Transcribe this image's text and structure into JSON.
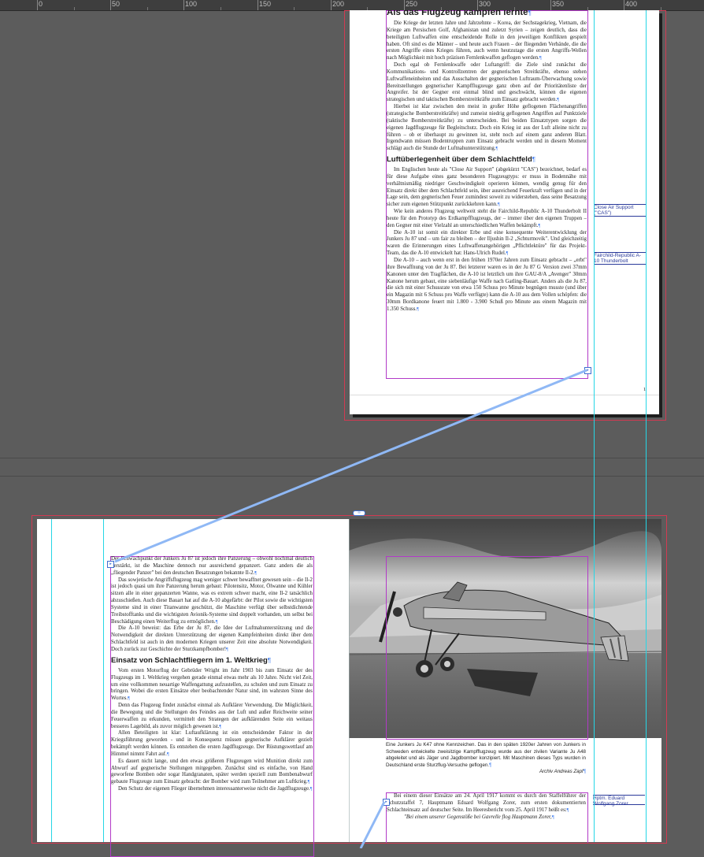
{
  "ruler": {
    "labels": [
      "0",
      "50",
      "100",
      "150",
      "200",
      "250",
      "300",
      "350",
      "400"
    ]
  },
  "page1": {
    "heading1": "Als das Flugzeug kämpfen lernte",
    "paragraphs1": [
      "Die Kriege der letzten Jahre und Jahrzehnte – Korea, der Sechstagekrieg, Vietnam, die Kriege am Persischen Golf, Afghanistan und zuletzt Syrien – zeigen deutlich, dass die beteiligten Luftwaffen eine entscheidende Rolle in den jeweiligen Konflikten gespielt haben. Oft sind es die Männer – und heute auch Frauen – der fliegenden Verbände, die die ersten Angriffe eines Krieges führen, auch wenn heutzutage die ersten Angriffs-Wellen nach Möglichkeit mit hoch präzisen Fernlenkwaffen geflogen werden.",
      "Doch egal ob Fernlenkwaffe oder Luftangriff: die Ziele sind zunächst die Kommunikations- und Kontrollzentren der gegnerischen Streitkräfte, ebenso stehen Luftwaffeneinheiten und das Ausschalten der gegnerischen Luftraum-Überwachung sowie Bereitstellungen gegnerischer Kampfflugzeuge ganz oben auf der Prioritätenliste der Angreifer. Ist der Gegner erst einmal blind und geschwächt, können die eigenen strategischen und taktischen Bomberstreitkräfte zum Einsatz gebracht werden.",
      "Hierbei ist klar zwischen den meist in großer Höhe geflogenen Flächenangriffen (strategische Bomberstreitkräfte) und zumeist niedrig geflogenen Angriffen auf Punktziele (taktische Bomberstreitkräfte) zu unterscheiden. Bei beiden Einsatztypen sorgen die eigenen Jagdflugzeuge für Begleitschutz. Doch ein Krieg ist aus der Luft alleine nicht zu führen – ob er überhaupt zu gewinnen ist, steht noch auf einem ganz anderen Blatt. Irgendwann müssen Bodentruppen zum Einsatz gebracht werden und in diesem Moment schlägt auch die Stunde der Luftnahunterstützung."
    ],
    "heading2": "Luftüberlegenheit über dem Schlachtfeld",
    "paragraphs2": [
      "Im Englischen heute als \"Close Air Support\" (abgekürzt \"CAS\") bezeichnet, bedarf es für diese Aufgabe eines ganz besonderen Flugzeugtyps: er muss in Bodennähe mit verhältnismäßig niedriger Geschwindigkeit operieren können, wendig genug für den Einsatz direkt über dem Schlachtfeld sein, über ausreichend Feuerkraft verfügen und in der Lage sein, dem gegnerischen Feuer zumindest soweit zu widerstehen, dass seine Besatzung sicher zum eigenen Stützpunkt zurückkehren kann.",
      "Wie kein anderes Flugzeug weltweit steht die Fairchild-Republic A-10 Thunderbolt II heute für den Prototyp des Erdkampfflugzeugs, der – immer über den eigenen Truppen – den Gegner mit einer Vielzahl an unterschiedlichen Waffen bekämpft.",
      "Die A-10 ist somit ein direkter Erbe und eine konsequente Weiterentwicklung der Junkers Ju 87 und – um fair zu bleiben – der Iljushin Il-2 „Schturmovik\". Und gleichzeitig waren die Erinnerungen eines Luftwaffenangehörigen „Pflichtlektüre\" für das Projekt-Team, das die A-10 entwickelt hat: Hans-Ulrich Rudel.",
      "Die A-10 – auch wenn erst in den frühen 1970er Jahren zum Einsatz gebracht – „erbt\" ihre Bewaffnung von der Ju 87. Bei letzterer waren es in der Ju 87 G Version zwei 37mm Kanonen unter den Tragflächen, die A-10 ist letztlich um ihre GAU-8/A „Avenger\" 30mm Kanone herum gebaut, eine siebenläufige Waffe nach Gatling-Bauart. Anders als die Ju 87, die sich mit einer Schussrate von etwa 150 Schuss pro Minute begnügen musste (und über ein Magazin mit 6 Schuss pro Waffe verfügte) kann die A-10 aus dem Vollen schöpfen: die 30mm Bordkanone feuert mit 1.800 - 3.900 Schuß pro Minute aus einem Magazin mit 1.350 Schuss."
    ],
    "note1": "Close Air Support (\"CAS\")",
    "note2": "Fairchild-Republic A-10 Thunderbolt",
    "page_number": "1"
  },
  "page2": {
    "paragraphs1": [
      "Der Schwachpunkt der Junkers Ju 87 ist jedoch ihre Panzerung – obwohl nochmal deutlich verstärkt, ist die Maschine dennoch nur ausreichend gepanzert. Ganz anders die als „fliegender Panzer\" bei den deutschen Besatzungen bekannte Il-2.",
      "Das sowjetische Angriffsflugzeug mag weniger schwer bewaffnet gewesen sein – die Il-2 ist jedoch quasi um ihre Panzerung herum gebaut: Pilotensitz, Motor, Ölwanne und Kühler sitzen alle in einer gepanzerten Wanne, was es extrem schwer macht, eine Il-2 tatsächlich abzuschießen. Auch diese Bauart hat auf die A-10 abgefärbt: der Pilot sowie die wichtigsten Systeme sind in einer Titanwanne geschützt, die Maschine verfügt über selbstdichtende Treibstofftanks und die wichtigsten Avionik-Systeme sind doppelt vorhanden, um selbst bei Beschädigung einen Weiterflug zu ermöglichen.",
      "Die A-10 beweist: das Erbe der Ju 87, die Idee der Luftnahunterstützung und die Notwendigkeit der direkten Unterstützung der eigenen Kampfeinheiten direkt über dem Schlachtfeld ist auch in den modernen Kriegen unserer Zeit eine absolute Notwendigkeit. Doch zurück zur Geschichte der Sturzkampfbomber!"
    ],
    "heading": "Einsatz von Schlachtfliegern im 1. Weltkrieg",
    "paragraphs2": [
      "Vom ersten Motorflug der Gebrüder Wright im Jahr 1903 bis zum Einsatz der des Flugzeugs im 1. Weltkrieg vergehen gerade einmal etwas mehr als 10 Jahre. Nicht viel Zeit, um eine vollkommen neuartige Waffengattung aufzustellen, zu schulen und zum Einsatz zu bringen. Wobei die ersten Einsätze eher beobachtender Natur sind, im wahrsten Sinne des Wortes.",
      "Denn das Flugzeug findet zunächst einmal als Aufklärer Verwendung. Die Möglichkeit, die Bewegung und die Stellungen des Feindes aus der Luft und außer Reichweite seiner Feuerwaffen zu erkunden, vermittelt den Strategen der aufklärenden Seite ein weitaus besseres Lagebild, als zuvor möglich gewesen ist.",
      "Allen Beteiligten ist klar: Luftaufklärung ist ein entscheidender Faktor in der Kriegsführung geworden - und in Konsequenz müssen gegnerische Aufklärer gezielt bekämpft werden können. Es entstehen die ersten Jagdflugzeuge. Der Rüstungswettlauf am Himmel nimmt Fahrt auf.",
      "Es dauert nicht lange, und den etwas größeren Flugzeugen wird Munition direkt zum Abwurf auf gegnerische Stellungen mitgegeben. Zunächst sind es einfache, von Hand geworfene Bomben oder sogar Handgranaten, später werden speziell zum Bombenabwurf gebaute Flugzeuge zum Einsatz gebracht: der Bomber wird zum Teilnehmer am Luftkrieg.",
      "Den Schutz der eigenen Flieger übernehmen interessanterweise nicht die Jagdflugzeuge."
    ],
    "caption": "Eine Junkers Ju K47 ohne Kennzeichen. Das in den späten 1920er Jahren von Junkers in Schweden entwickelte zweisitzige Kampfflugzeug wurde aus der zivilen Variante Ju A48 abgeleitet und als Jäger und Jagdbomber konzipiert. Mit Maschinen dieses Typs wurden in Deutschland erste Sturzflug-Versuche geflogen.",
    "caption_credit": "Archiv Andreas Zapf",
    "paragraph3": "Bei einem dieser Einsätze am 24. April 1917 kommt es durch den Staffelführer der Schutzstaffel 7, Hauptmann Eduard Wolfgang Zorer, zum ersten dokumentierten Schlachteinsatz auf deutscher Seite. Im Heeresbericht vom 25. April 1917 heißt es:",
    "quote": "\"Bei einem unserer Gegenstöße bei Gavrelle flog Hauptmann Zorer,",
    "note": "Hptm. Eduard Wolfgang Zorer"
  },
  "colors": {
    "pasteboard": "#5c5c5c",
    "guide": "#25d6e6",
    "bleed": "#d23a52",
    "frame": "#b23ac7",
    "thread": "#8fb8f5"
  }
}
